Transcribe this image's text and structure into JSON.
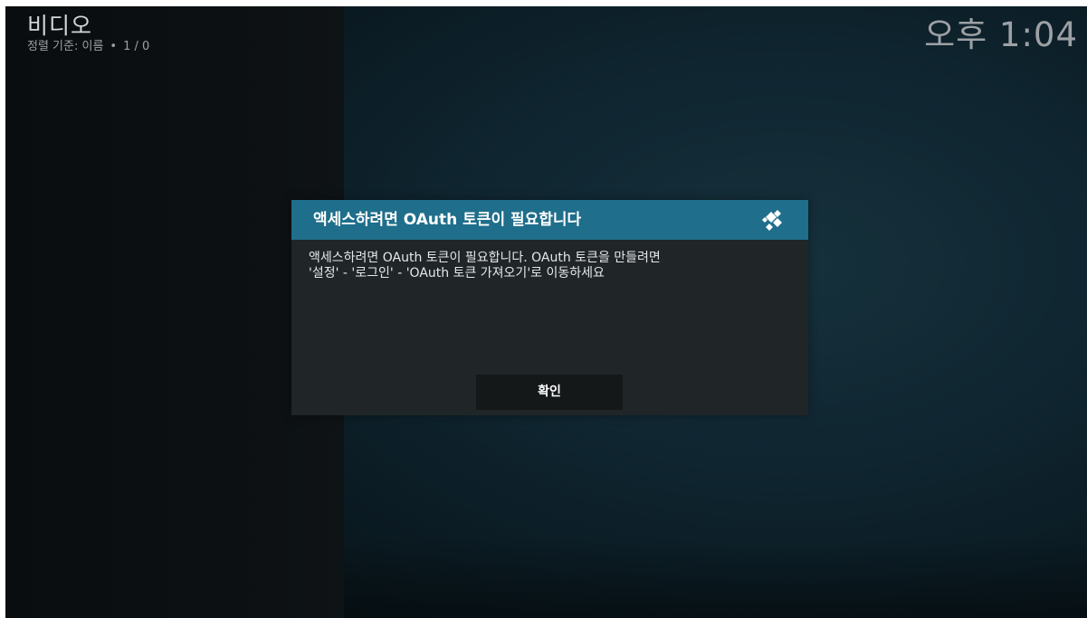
{
  "header": {
    "title": "비디오",
    "sort_label": "정렬 기준: 이름",
    "separator": "•",
    "count": "1 / 0"
  },
  "clock": "오후 1:04",
  "dialog": {
    "title": "액세스하려면 OAuth 토큰이 필요합니다",
    "message_line1": "액세스하려면 OAuth 토큰이 필요합니다. OAuth 토큰을 만들려면",
    "message_line2": "'설정' - '로그인' - 'OAuth 토큰 가져오기'로 이동하세요",
    "ok_label": "확인",
    "logo_icon": "kodi-logo-icon"
  },
  "colors": {
    "header_bar": "#1f6e8b",
    "dialog_bg": "#202527",
    "button_bg": "#151819"
  }
}
